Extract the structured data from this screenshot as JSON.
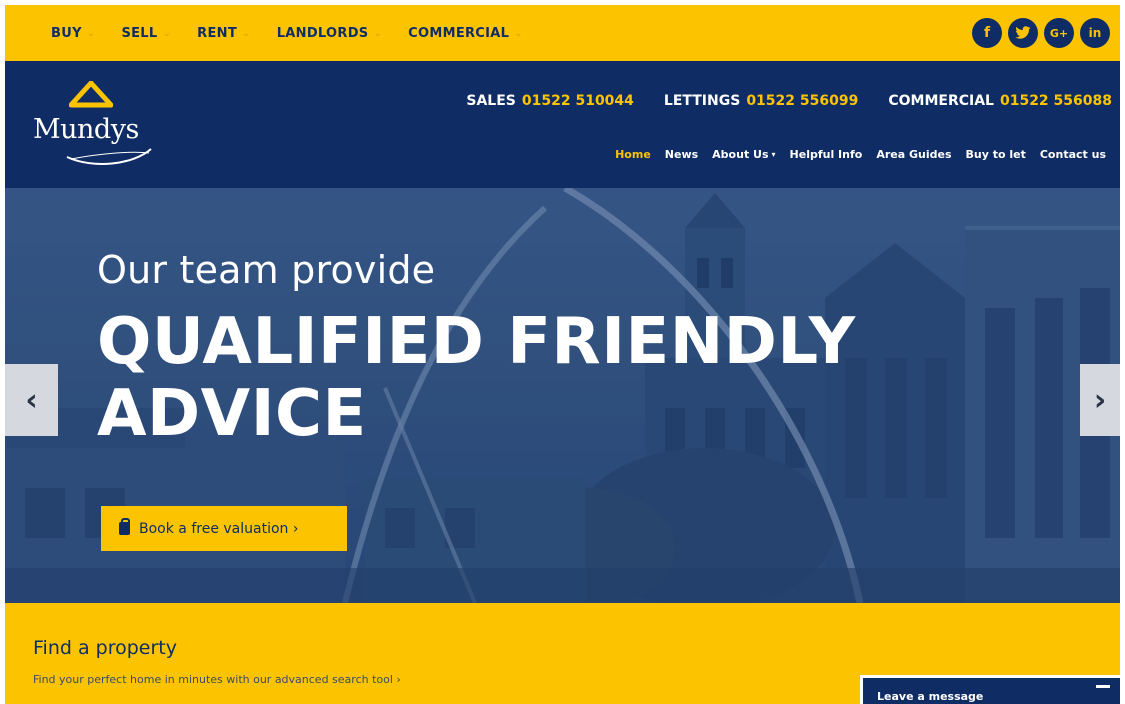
{
  "topnav": {
    "items": [
      {
        "label": "BUY"
      },
      {
        "label": "SELL"
      },
      {
        "label": "RENT"
      },
      {
        "label": "LANDLORDS"
      },
      {
        "label": "COMMERCIAL"
      }
    ]
  },
  "social": {
    "facebook": "f",
    "twitter": "t",
    "googleplus": "G+",
    "linkedin": "in"
  },
  "header": {
    "logo_text": "Mundys",
    "contacts": [
      {
        "label": "SALES",
        "number": "01522 510044"
      },
      {
        "label": "LETTINGS",
        "number": "01522 556099"
      },
      {
        "label": "COMMERCIAL",
        "number": "01522 556088"
      }
    ],
    "nav": [
      {
        "label": "Home"
      },
      {
        "label": "News"
      },
      {
        "label": "About Us"
      },
      {
        "label": "Helpful Info"
      },
      {
        "label": "Area Guides"
      },
      {
        "label": "Buy to let"
      },
      {
        "label": "Contact us"
      }
    ]
  },
  "hero": {
    "subtitle": "Our team provide",
    "title": "QUALIFIED FRIENDLY ADVICE",
    "cta_label": "Book a free valuation ›",
    "prev_arrow": "‹",
    "next_arrow": "›"
  },
  "find": {
    "title": "Find a property",
    "text": "Find your perfect home in minutes with our advanced search tool ›"
  },
  "chat": {
    "label": "Leave a message"
  },
  "colors": {
    "brand_yellow": "#fcc400",
    "brand_navy": "#0f2d64"
  }
}
